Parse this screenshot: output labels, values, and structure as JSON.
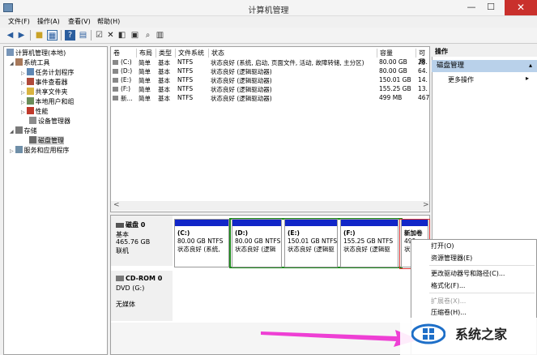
{
  "window": {
    "title": "计算机管理",
    "min": "—",
    "max": "☐",
    "close": "✕"
  },
  "menu": [
    "文件(F)",
    "操作(A)",
    "查看(V)",
    "帮助(H)"
  ],
  "tree": {
    "root": "计算机管理(本地)",
    "system_tools": "系统工具",
    "task_scheduler": "任务计划程序",
    "event_viewer": "事件查看器",
    "shared_folders": "共享文件夹",
    "local_users": "本地用户和组",
    "performance": "性能",
    "device_manager": "设备管理器",
    "storage": "存储",
    "disk_management": "磁盘管理",
    "services": "服务和应用程序"
  },
  "volume_table": {
    "headers": [
      "卷",
      "布局",
      "类型",
      "文件系统",
      "状态",
      "容量",
      "可用"
    ],
    "rows": [
      [
        "(C:)",
        "简单",
        "基本",
        "NTFS",
        "状态良好 (系统, 启动, 页面文件, 活动, 故障转储, 主分区)",
        "80.00 GB",
        "28."
      ],
      [
        "(D:)",
        "简单",
        "基本",
        "NTFS",
        "状态良好 (逻辑驱动器)",
        "80.00 GB",
        "64."
      ],
      [
        "(E:)",
        "简单",
        "基本",
        "NTFS",
        "状态良好 (逻辑驱动器)",
        "150.01 GB",
        "14."
      ],
      [
        "(F:)",
        "简单",
        "基本",
        "NTFS",
        "状态良好 (逻辑驱动器)",
        "155.25 GB",
        "13."
      ],
      [
        "新...",
        "简单",
        "基本",
        "NTFS",
        "状态良好 (逻辑驱动器)",
        "499 MB",
        "467"
      ]
    ]
  },
  "scroll_left": "<",
  "scroll_right": ">",
  "disk0": {
    "name": "磁盘 0",
    "type": "基本",
    "size": "465.76 GB",
    "status": "联机"
  },
  "partitions": [
    {
      "letter": "(C:)",
      "size": "80.00 GB NTFS",
      "status": "状态良好 (系统,"
    },
    {
      "letter": "(D:)",
      "size": "80.00 GB NTFS",
      "status": "状态良好 (逻辑"
    },
    {
      "letter": "(E:)",
      "size": "150.01 GB NTFS",
      "status": "状态良好 (逻辑驱"
    },
    {
      "letter": "(F:)",
      "size": "155.25 GB NTFS",
      "status": "状态良好 (逻辑驱"
    },
    {
      "letter": "新加卷",
      "size": "499",
      "status": "状态"
    }
  ],
  "cdrom": {
    "name": "CD-ROM 0",
    "type": "DVD (G:)",
    "status": "无媒体"
  },
  "actions": {
    "header": "操作",
    "section": "磁盘管理",
    "more": "更多操作",
    "arrow": "▸"
  },
  "context_menu": [
    "打开(O)",
    "资源管理器(E)",
    "更改驱动器号和路径(C)...",
    "格式化(F)...",
    "扩展卷(X)...",
    "压缩卷(H)..."
  ],
  "watermark": "系统之家"
}
